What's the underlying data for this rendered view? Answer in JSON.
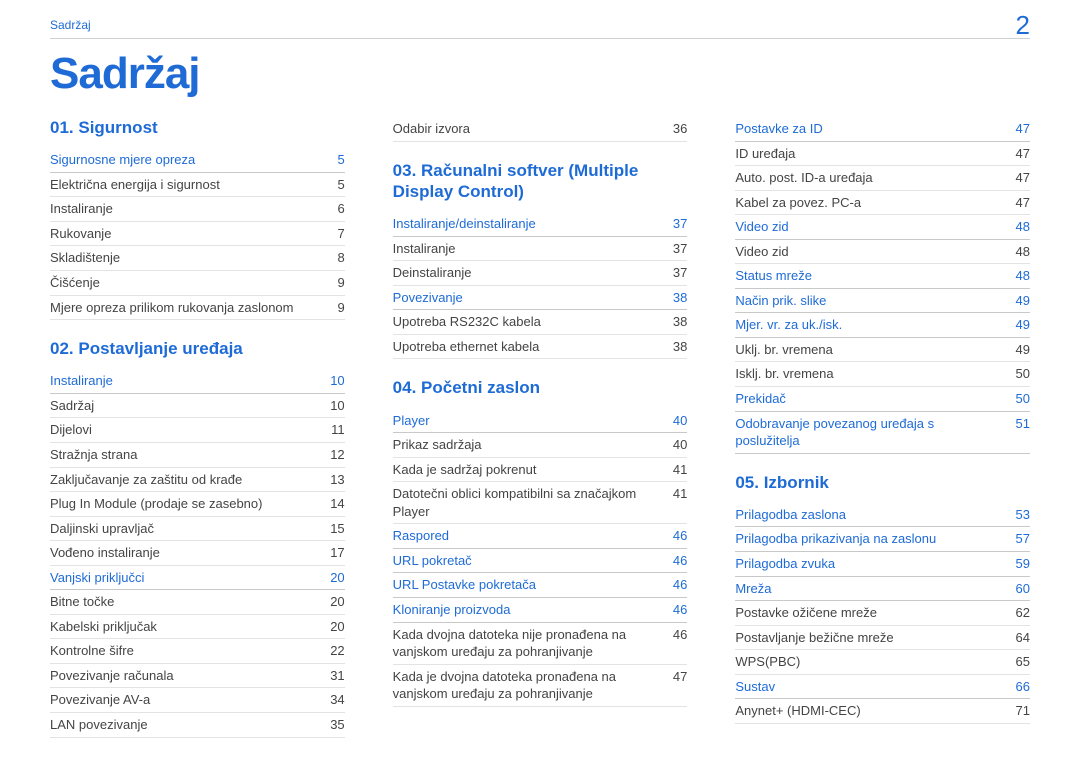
{
  "breadcrumb": "Sadržaj",
  "page_number": "2",
  "title": "Sadržaj",
  "col1": {
    "sec1": {
      "heading": "01. Sigurnost",
      "sub1": {
        "label": "Sigurnosne mjere opreza",
        "pg": "5"
      },
      "items1": [
        {
          "label": "Električna energija i sigurnost",
          "pg": "5"
        },
        {
          "label": "Instaliranje",
          "pg": "6"
        },
        {
          "label": "Rukovanje",
          "pg": "7"
        },
        {
          "label": "Skladištenje",
          "pg": "8"
        },
        {
          "label": "Čišćenje",
          "pg": "9"
        },
        {
          "label": "Mjere opreza prilikom rukovanja zaslonom",
          "pg": "9"
        }
      ]
    },
    "sec2": {
      "heading": "02. Postavljanje uređaja",
      "sub1": {
        "label": "Instaliranje",
        "pg": "10"
      },
      "items1": [
        {
          "label": "Sadržaj",
          "pg": "10"
        },
        {
          "label": "Dijelovi",
          "pg": "11"
        },
        {
          "label": "Stražnja strana",
          "pg": "12"
        },
        {
          "label": "Zaključavanje za zaštitu od krađe",
          "pg": "13"
        },
        {
          "label": "Plug In Module (prodaje se zasebno)",
          "pg": "14"
        },
        {
          "label": "Daljinski upravljač",
          "pg": "15"
        },
        {
          "label": "Vođeno instaliranje",
          "pg": "17"
        }
      ],
      "sub2": {
        "label": "Vanjski priključci",
        "pg": "20"
      },
      "items2": [
        {
          "label": "Bitne točke",
          "pg": "20"
        },
        {
          "label": "Kabelski priključak",
          "pg": "20"
        },
        {
          "label": "Kontrolne šifre",
          "pg": "22"
        },
        {
          "label": "Povezivanje računala",
          "pg": "31"
        },
        {
          "label": "Povezivanje AV-a",
          "pg": "34"
        },
        {
          "label": "LAN povezivanje",
          "pg": "35"
        }
      ]
    }
  },
  "col2": {
    "top_items": [
      {
        "label": "Odabir izvora",
        "pg": "36"
      }
    ],
    "sec3": {
      "heading": "03. Računalni softver (Multiple Display Control)",
      "sub1": {
        "label": "Instaliranje/deinstaliranje",
        "pg": "37"
      },
      "items1": [
        {
          "label": "Instaliranje",
          "pg": "37"
        },
        {
          "label": "Deinstaliranje",
          "pg": "37"
        }
      ],
      "sub2": {
        "label": "Povezivanje",
        "pg": "38"
      },
      "items2": [
        {
          "label": "Upotreba RS232C kabela",
          "pg": "38"
        },
        {
          "label": "Upotreba ethernet kabela",
          "pg": "38"
        }
      ]
    },
    "sec4": {
      "heading": "04. Početni zaslon",
      "sub1": {
        "label": "Player",
        "pg": "40"
      },
      "items1": [
        {
          "label": "Prikaz sadržaja",
          "pg": "40"
        },
        {
          "label": "Kada je sadržaj pokrenut",
          "pg": "41"
        },
        {
          "label": "Datotečni oblici kompatibilni sa značajkom Player",
          "pg": "41"
        }
      ],
      "sub2": {
        "label": "Raspored",
        "pg": "46"
      },
      "sub3": {
        "label": "URL pokretač",
        "pg": "46"
      },
      "sub4": {
        "label": "URL Postavke pokretača",
        "pg": "46"
      },
      "sub5": {
        "label": "Kloniranje proizvoda",
        "pg": "46"
      },
      "items5": [
        {
          "label": "Kada dvojna datoteka nije pronađena na vanjskom uređaju za pohranjivanje",
          "pg": "46"
        },
        {
          "label": "Kada je dvojna datoteka pronađena na vanjskom uređaju za pohranjivanje",
          "pg": "47"
        }
      ]
    }
  },
  "col3": {
    "sub_top": {
      "label": "Postavke za ID",
      "pg": "47"
    },
    "items_top": [
      {
        "label": "ID uređaja",
        "pg": "47"
      },
      {
        "label": "Auto. post. ID-a uređaja",
        "pg": "47"
      },
      {
        "label": "Kabel za povez. PC-a",
        "pg": "47"
      }
    ],
    "sub2": {
      "label": "Video zid",
      "pg": "48"
    },
    "items2": [
      {
        "label": "Video zid",
        "pg": "48"
      }
    ],
    "sub3": {
      "label": "Status mreže",
      "pg": "48"
    },
    "sub4": {
      "label": "Način prik. slike",
      "pg": "49"
    },
    "sub5": {
      "label": "Mjer. vr. za uk./isk.",
      "pg": "49"
    },
    "items5": [
      {
        "label": "Uklj. br. vremena",
        "pg": "49"
      },
      {
        "label": "Isklj. br. vremena",
        "pg": "50"
      }
    ],
    "sub6": {
      "label": "Prekidač",
      "pg": "50"
    },
    "sub7": {
      "label": "Odobravanje povezanog uređaja s poslužitelja",
      "pg": "51"
    },
    "sec5": {
      "heading": "05. Izbornik",
      "sub1": {
        "label": "Prilagodba zaslona",
        "pg": "53"
      },
      "sub2": {
        "label": "Prilagodba prikazivanja na zaslonu",
        "pg": "57"
      },
      "sub3": {
        "label": "Prilagodba zvuka",
        "pg": "59"
      },
      "sub4": {
        "label": "Mreža",
        "pg": "60"
      },
      "items4": [
        {
          "label": "Postavke ožičene mreže",
          "pg": "62"
        },
        {
          "label": "Postavljanje bežične mreže",
          "pg": "64"
        },
        {
          "label": "WPS(PBC)",
          "pg": "65"
        }
      ],
      "sub5": {
        "label": "Sustav",
        "pg": "66"
      },
      "items5": [
        {
          "label": "Anynet+ (HDMI-CEC)",
          "pg": "71"
        }
      ]
    }
  }
}
